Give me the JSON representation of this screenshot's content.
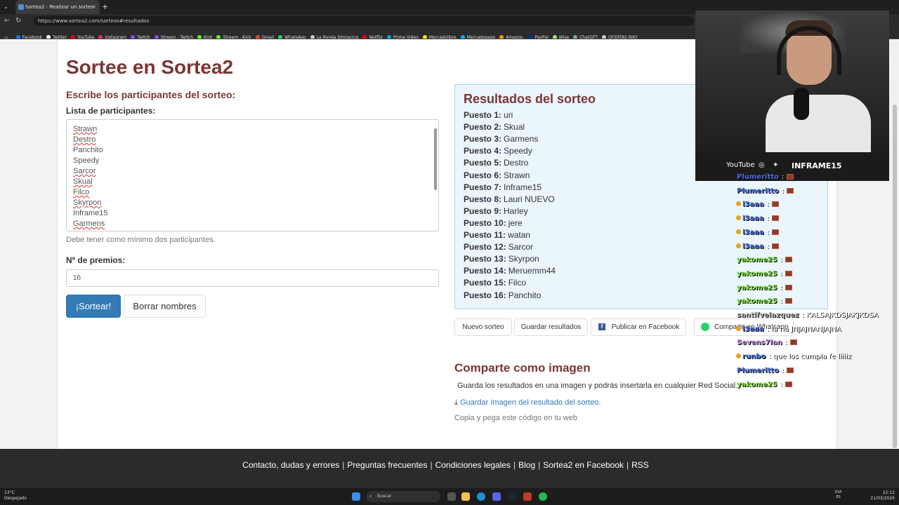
{
  "browser": {
    "tab_title": "Sortea2 - Realizar un sorteo",
    "url": "https://www.sortea2.com/sorteos#resultados",
    "bookmarks": [
      "Facebook",
      "Twitter",
      "YouTube",
      "Instagram",
      "Twitch",
      "Stream - Twitch",
      "Kick",
      "Stream - Kick",
      "Gmail",
      "WhatsApp",
      "La Ronda Simracing",
      "Netflix",
      "Prime Video",
      "Mercadolibre",
      "Mercadopago",
      "Amazon.",
      "PayPal",
      "Wise",
      "ChatGPT",
      "OFERTAS RIKY"
    ],
    "bookmark_colors": [
      "#1877f2",
      "#ffffff",
      "#ff0000",
      "#e1306c",
      "#9146ff",
      "#9146ff",
      "#53fc18",
      "#53fc18",
      "#ea4335",
      "#25d366",
      "#cccccc",
      "#e50914",
      "#00a8e1",
      "#ffe600",
      "#00b1ea",
      "#ff9900",
      "#003087",
      "#9fe870",
      "#74aa9c",
      "#cccccc"
    ]
  },
  "page": {
    "title": "Sortee en Sortea2",
    "participants_heading": "Escribe los participantes del sorteo:",
    "list_label": "Lista de participantes:",
    "participants": [
      "Strawn",
      "Destro",
      "Panchito",
      "Speedy",
      "Sarcor",
      "Skual",
      "Filco",
      "Skyrpon",
      "Inframe15",
      "Garmens"
    ],
    "spellcheck_flags": [
      true,
      true,
      false,
      false,
      true,
      true,
      true,
      true,
      false,
      true
    ],
    "help_text": "Debe tener como mínimo dos participantes.",
    "prizes_label": "Nº de premios:",
    "prizes_value": "16",
    "draw_button": "¡Sortear!",
    "clear_button": "Borrar nombres"
  },
  "results": {
    "title": "Resultados del sorteo",
    "rows": [
      {
        "label": "Puesto 1:",
        "name": "uri"
      },
      {
        "label": "Puesto 2:",
        "name": "Skual"
      },
      {
        "label": "Puesto 3:",
        "name": "Garmens"
      },
      {
        "label": "Puesto 4:",
        "name": "Speedy"
      },
      {
        "label": "Puesto 5:",
        "name": "Destro"
      },
      {
        "label": "Puesto 6:",
        "name": "Strawn"
      },
      {
        "label": "Puesto 7:",
        "name": "Inframe15"
      },
      {
        "label": "Puesto 8:",
        "name": "Lauri NUEVO"
      },
      {
        "label": "Puesto 9:",
        "name": "Harley"
      },
      {
        "label": "Puesto 10:",
        "name": "jere"
      },
      {
        "label": "Puesto 11:",
        "name": "watan"
      },
      {
        "label": "Puesto 12:",
        "name": "Sarcor"
      },
      {
        "label": "Puesto 13:",
        "name": "Skyrpon"
      },
      {
        "label": "Puesto 14:",
        "name": "Meruemm44"
      },
      {
        "label": "Puesto 15:",
        "name": "Filco"
      },
      {
        "label": "Puesto 16:",
        "name": "Panchito"
      }
    ],
    "buttons": {
      "new": "Nuevo sorteo",
      "save": "Guardar resultados",
      "facebook": "Publicar en Facebook",
      "whatsapp": "Comparte en Whatsapp"
    }
  },
  "share": {
    "title": "Comparte como imagen",
    "description": "Guarda los resultados en una imagen y podrás insertarla en cualquier Red Social.",
    "download_link": "Guardar Imagen del resultado del sorteo.",
    "code_text": "Copia y pega este código en tu web"
  },
  "footer": {
    "links": [
      "Contacto, dudas y errores",
      "Preguntas frecuentes",
      "Condiciones legales",
      "Blog",
      "Sortea2 en Facebook",
      "RSS"
    ],
    "separator": "|"
  },
  "taskbar": {
    "temperature": "13°C",
    "weather": "Despejado",
    "search_placeholder": "Buscar",
    "language_top": "ESP",
    "language_bottom": "ES",
    "time": "22:12",
    "date": "21/03/2026"
  },
  "overlay": {
    "youtube": "YouTube",
    "brand": "INFRAME15",
    "chat": [
      {
        "user": "Plumeritto",
        "text": ":",
        "color": "#4a6fe0",
        "emote": true,
        "badge": false
      },
      {
        "user": "Plumeritto",
        "text": ":",
        "color": "#4a6fe0",
        "emote": true,
        "badge": false
      },
      {
        "user": "l3aaa",
        "text": ":",
        "color": "#4a6fe0",
        "emote": true,
        "badge": true
      },
      {
        "user": "l3aaa",
        "text": ":",
        "color": "#4a6fe0",
        "emote": true,
        "badge": true
      },
      {
        "user": "l3aaa",
        "text": ":",
        "color": "#4a6fe0",
        "emote": true,
        "badge": true
      },
      {
        "user": "l3aaa",
        "text": ":",
        "color": "#4a6fe0",
        "emote": true,
        "badge": true
      },
      {
        "user": "yakome25",
        "text": ":",
        "color": "#7ddc3c",
        "emote": true,
        "badge": false
      },
      {
        "user": "yakome25",
        "text": ":",
        "color": "#7ddc3c",
        "emote": true,
        "badge": false
      },
      {
        "user": "yakome25",
        "text": ":",
        "color": "#7ddc3c",
        "emote": true,
        "badge": false
      },
      {
        "user": "yakome25",
        "text": ":",
        "color": "#7ddc3c",
        "emote": true,
        "badge": false
      },
      {
        "user": "santifvelazquez",
        "text": ": KALSAJKDSJAKJKDSA",
        "color": "#b0b0b0",
        "emote": false,
        "badge": false
      },
      {
        "user": "l3aaa",
        "text": ": la na JNJAJNANJAJNA",
        "color": "#4a6fe0",
        "emote": false,
        "badge": true
      },
      {
        "user": "Sevens7lan",
        "text": ":",
        "color": "#c38ae8",
        "emote": true,
        "badge": false
      },
      {
        "user": "runbo",
        "text": ": que los cumpla fe liiiiz",
        "color": "#3b6fd8",
        "emote": false,
        "badge": true
      },
      {
        "user": "Plumeritto",
        "text": ":",
        "color": "#4a6fe0",
        "emote": true,
        "badge": false
      },
      {
        "user": "yakome25",
        "text": ":",
        "color": "#7ddc3c",
        "emote": true,
        "badge": false
      }
    ]
  }
}
